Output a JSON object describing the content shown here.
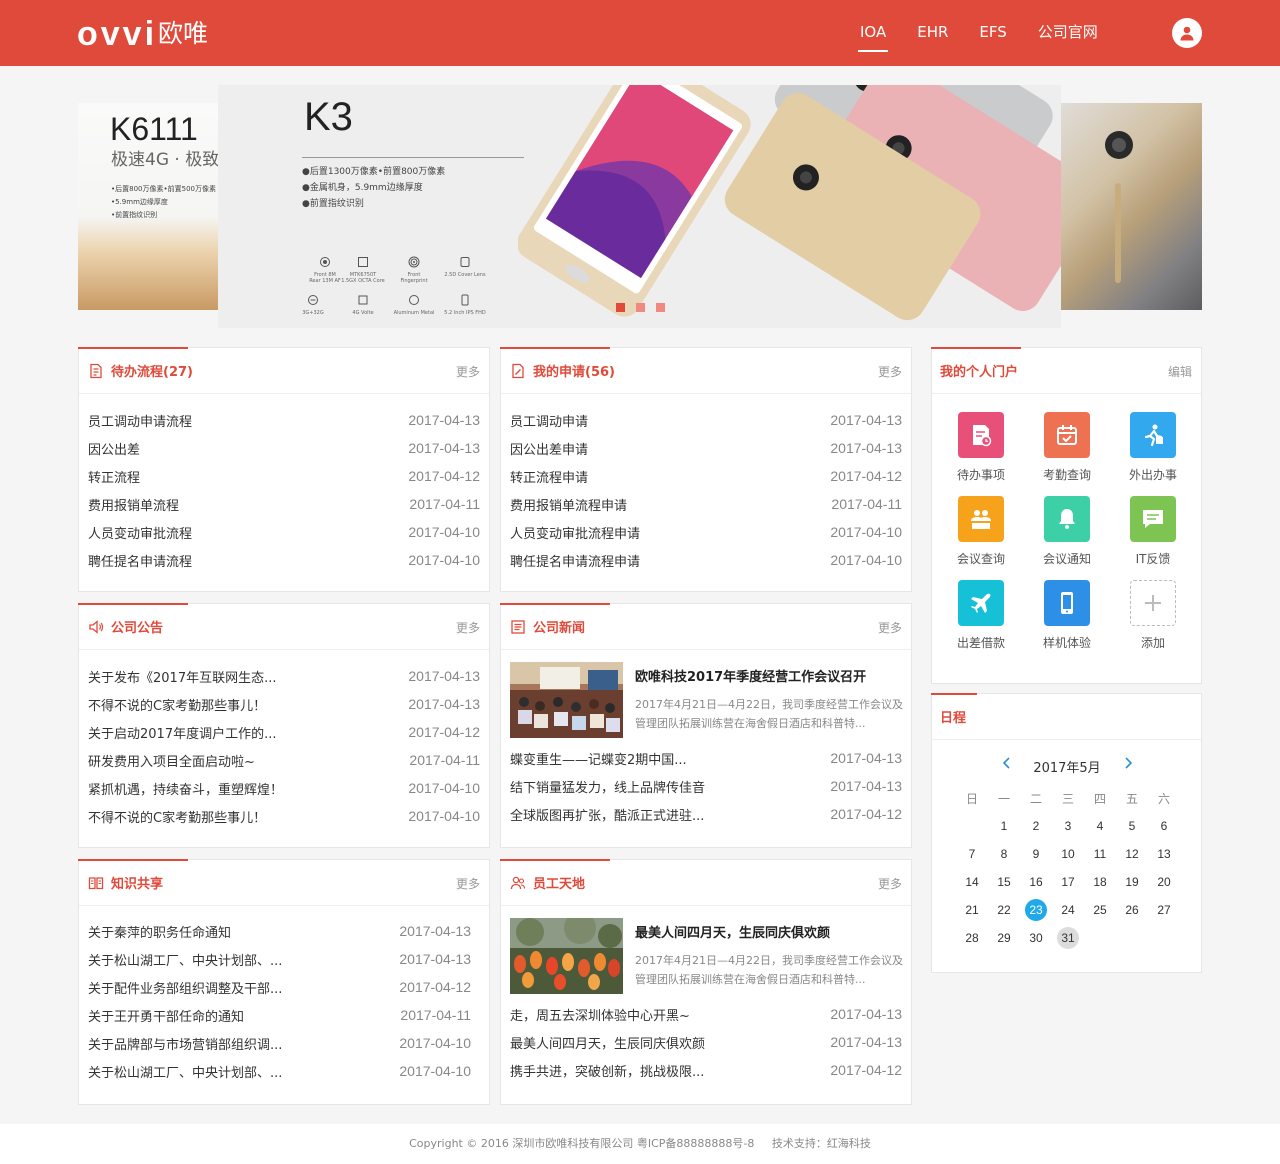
{
  "header": {
    "logo_latin": "ovvi",
    "logo_cn": "欧唯",
    "nav": [
      {
        "label": "IOA",
        "active": true
      },
      {
        "label": "EHR",
        "active": false
      },
      {
        "label": "EFS",
        "active": false
      },
      {
        "label": "公司官网",
        "active": false
      }
    ],
    "avatar_icon": "user-icon",
    "color": "#e04a3a"
  },
  "banner": {
    "left": {
      "model": "K6111",
      "tagline": "极速4G · 极致",
      "features": [
        "•后置800万像素•前置500万像素",
        "•5.9mm边缘厚度",
        "•前置指纹识别"
      ]
    },
    "main": {
      "model": "K3",
      "features": [
        "●后置1300万像素•前置800万像素",
        "●金属机身，5.9mm边缘厚度",
        "●前置指纹识别"
      ],
      "specs": [
        {
          "icon": "camera-icon",
          "label": "Front 8M\nRear 13M AF"
        },
        {
          "icon": "chip-icon",
          "label": "MTK6750T\n1.5GX OCTA Core"
        },
        {
          "icon": "fingerprint-icon",
          "label": "Front\nFingerprint"
        },
        {
          "icon": "glass-icon",
          "label": "2.5D Cover Lens"
        },
        {
          "icon": "memory-icon",
          "label": "3G+32G"
        },
        {
          "icon": "network-icon",
          "label": "4G Volte"
        },
        {
          "icon": "metal-icon",
          "label": "Aluminum Metal"
        },
        {
          "icon": "screen-icon",
          "label": "5.2 Inch IPS FHD"
        }
      ]
    },
    "dots": 3,
    "active_dot": 0
  },
  "more_label": "更多",
  "todo": {
    "title": "待办流程(27)",
    "icon": "document-list-icon",
    "items": [
      {
        "title": "员工调动申请流程",
        "date": "2017-04-13"
      },
      {
        "title": "因公出差",
        "date": "2017-04-13"
      },
      {
        "title": "转正流程",
        "date": "2017-04-12"
      },
      {
        "title": "费用报销单流程",
        "date": "2017-04-11"
      },
      {
        "title": "人员变动审批流程",
        "date": "2017-04-10"
      },
      {
        "title": "聘任提名申请流程",
        "date": "2017-04-10"
      }
    ]
  },
  "my_apply": {
    "title": "我的申请(56)",
    "icon": "edit-document-icon",
    "items": [
      {
        "title": "员工调动申请",
        "date": "2017-04-13"
      },
      {
        "title": "因公出差申请",
        "date": "2017-04-13"
      },
      {
        "title": "转正流程申请",
        "date": "2017-04-12"
      },
      {
        "title": "费用报销单流程申请",
        "date": "2017-04-11"
      },
      {
        "title": "人员变动审批流程申请",
        "date": "2017-04-10"
      },
      {
        "title": "聘任提名申请流程申请",
        "date": "2017-04-10"
      }
    ]
  },
  "notice": {
    "title": "公司公告",
    "icon": "speaker-icon",
    "items": [
      {
        "title": "关于发布《2017年互联网生态...",
        "date": "2017-04-13"
      },
      {
        "title": "不得不说的C家考勤那些事儿！",
        "date": "2017-04-13"
      },
      {
        "title": "关于启动2017年度调户工作的...",
        "date": "2017-04-12"
      },
      {
        "title": "研发费用入项目全面启动啦~",
        "date": "2017-04-11"
      },
      {
        "title": "紧抓机遇，持续奋斗，重塑辉煌！",
        "date": "2017-04-10"
      },
      {
        "title": "不得不说的C家考勤那些事儿！",
        "date": "2017-04-10"
      }
    ]
  },
  "news": {
    "title": "公司新闻",
    "icon": "newspaper-icon",
    "feature": {
      "title": "欧唯科技2017年季度经营工作会议召开",
      "desc": "2017年4月21日—4月22日，我司季度经营工作会议及管理团队拓展训练营在海舍假日酒店和科普特..."
    },
    "items": [
      {
        "title": "蝶变重生——记蝶变2期中国...",
        "date": "2017-04-13"
      },
      {
        "title": "结下销量猛发力，线上品牌传佳音",
        "date": "2017-04-13"
      },
      {
        "title": "全球版图再扩张，酷派正式进驻...",
        "date": "2017-04-12"
      }
    ]
  },
  "knowledge": {
    "title": "知识共享",
    "icon": "open-book-icon",
    "items": [
      {
        "title": "关于秦萍的职务任命通知",
        "date": "2017-04-13"
      },
      {
        "title": "关于松山湖工厂、中央计划部、...",
        "date": "2017-04-13"
      },
      {
        "title": "关于配件业务部组织调整及干部...",
        "date": "2017-04-12"
      },
      {
        "title": "关于王开勇干部任命的通知",
        "date": "2017-04-11"
      },
      {
        "title": "关于品牌部与市场营销部组织调...",
        "date": "2017-04-10"
      },
      {
        "title": "关于松山湖工厂、中央计划部、...",
        "date": "2017-04-10"
      }
    ]
  },
  "staff": {
    "title": "员工天地",
    "icon": "people-icon",
    "feature": {
      "title": "最美人间四月天，生辰同庆俱欢颜",
      "desc": "2017年4月21日—4月22日，我司季度经营工作会议及管理团队拓展训练营在海舍假日酒店和科普特..."
    },
    "items": [
      {
        "title": "走，周五去深圳体验中心开黑~",
        "date": "2017-04-13"
      },
      {
        "title": "最美人间四月天，生辰同庆俱欢颜",
        "date": "2017-04-13"
      },
      {
        "title": "携手共进，突破创新，挑战极限...",
        "date": "2017-04-12"
      }
    ]
  },
  "portal": {
    "title": "我的个人门户",
    "edit_label": "编辑",
    "apps": [
      {
        "label": "待办事项",
        "icon": "todo-doc-icon",
        "color": "#e8507a"
      },
      {
        "label": "考勤查询",
        "icon": "calendar-check-icon",
        "color": "#ee7252"
      },
      {
        "label": "外出办事",
        "icon": "runner-icon",
        "color": "#32a8ef"
      },
      {
        "label": "会议查询",
        "icon": "meeting-icon",
        "color": "#f7a21b"
      },
      {
        "label": "会议通知",
        "icon": "bell-icon",
        "color": "#3dcfa6"
      },
      {
        "label": "IT反馈",
        "icon": "chat-icon",
        "color": "#7dc453"
      },
      {
        "label": "出差借款",
        "icon": "airplane-icon",
        "color": "#16c0d6"
      },
      {
        "label": "样机体验",
        "icon": "phone-icon",
        "color": "#2d8fe6"
      },
      {
        "label": "添加",
        "icon": "plus-icon",
        "color": "#cccccc"
      }
    ]
  },
  "calendar": {
    "title": "日程",
    "month_label": "2017年5月",
    "weekdays": [
      "日",
      "一",
      "二",
      "三",
      "四",
      "五",
      "六"
    ],
    "weeks": [
      [
        "",
        "1",
        "2",
        "3",
        "4",
        "5",
        "6"
      ],
      [
        "7",
        "8",
        "9",
        "10",
        "11",
        "12",
        "13"
      ],
      [
        "14",
        "15",
        "16",
        "17",
        "18",
        "19",
        "20"
      ],
      [
        "21",
        "22",
        "23",
        "24",
        "25",
        "26",
        "27"
      ],
      [
        "28",
        "29",
        "30",
        "31",
        "",
        "",
        ""
      ]
    ],
    "today": "23",
    "highlight": "31"
  },
  "footer": {
    "text": "Copyright © 2016 深圳市欧唯科技有限公司 粤ICP备88888888号-8     技术支持：红海科技"
  }
}
